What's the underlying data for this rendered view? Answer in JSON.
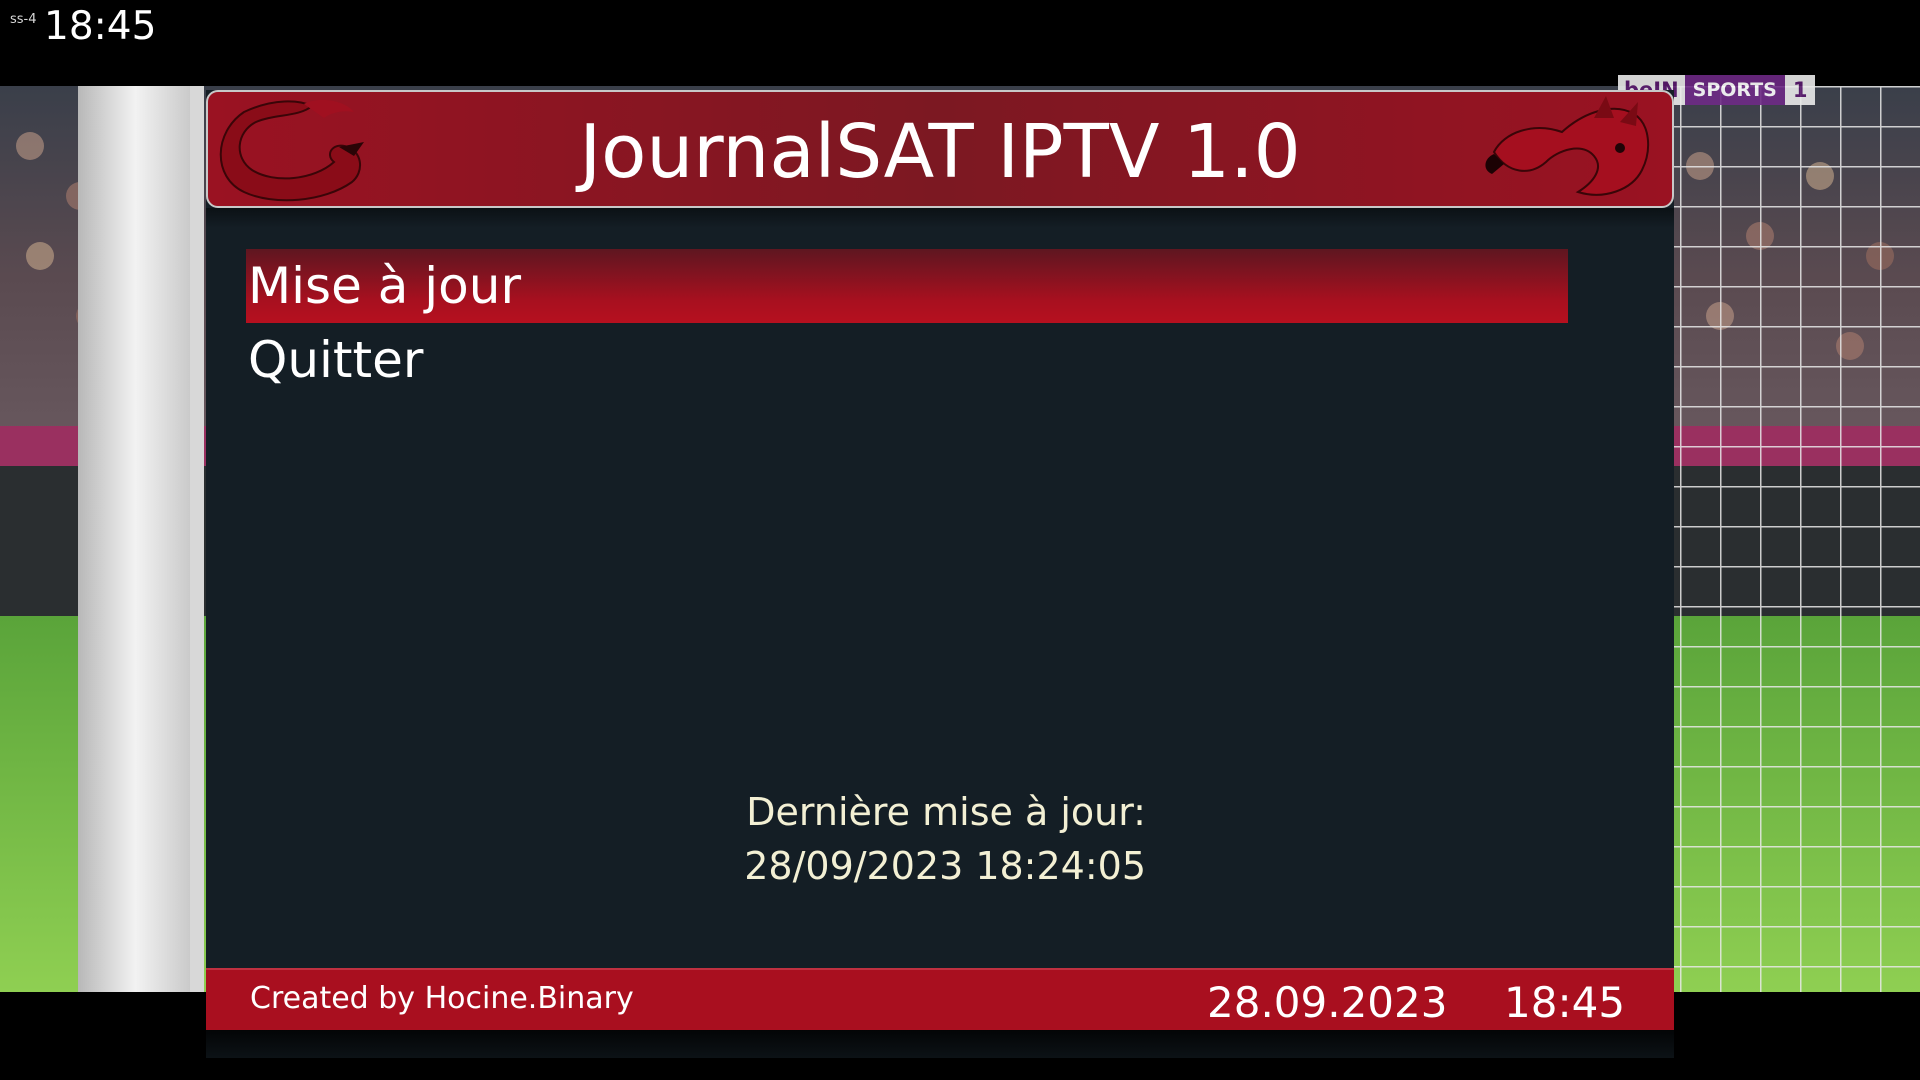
{
  "osd": {
    "tag": "ss-4",
    "clock": "18:45"
  },
  "channel_logo": {
    "brand": "beIN",
    "sports": "SPORTS",
    "number": "1"
  },
  "plugin": {
    "title": "JournalSAT IPTV 1.0",
    "menu": [
      {
        "label": "Mise à jour",
        "selected": true
      },
      {
        "label": "Quitter",
        "selected": false
      }
    ],
    "last_update_label": "Dernière mise à jour:",
    "last_update_value": "28/09/2023 18:24:05"
  },
  "footer": {
    "credit": "Created by Hocine.Binary",
    "date": "28.09.2023",
    "time": "18:45"
  },
  "colors": {
    "accent_red": "#a90f1f",
    "panel_background": "#141e25",
    "info_text": "#f3f0d4"
  },
  "icons": {
    "title_left": "dragon-icon",
    "title_right": "dragon-icon"
  }
}
